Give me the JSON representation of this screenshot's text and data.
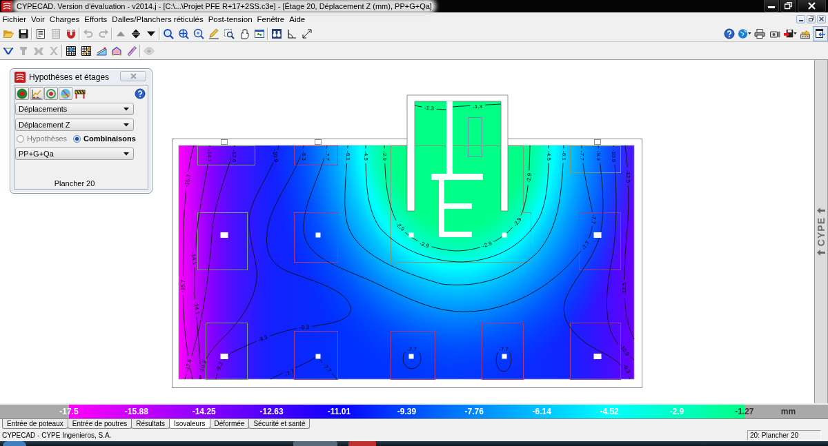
{
  "window": {
    "title": "CYPECAD. Version d'évaluation - v2014.j - [C:\\...\\Projet PFE R+17+2SS.c3e] - [Étage 20, Déplacement Z (mm), PP+G+Qa]"
  },
  "menu": [
    "Fichier",
    "Voir",
    "Charges",
    "Efforts",
    "Dalles/Planchers réticulés",
    "Post-tension",
    "Fenêtre",
    "Aide"
  ],
  "toolbar_main": [
    {
      "disabled": false
    },
    {
      "disabled": false
    },
    {
      "disabled": false
    },
    {
      "disabled": true
    },
    {
      "disabled": false
    },
    {
      "disabled": true
    },
    {
      "disabled": true
    },
    {
      "disabled": true
    },
    {
      "disabled": false
    },
    {
      "disabled": false
    },
    {
      "disabled": false
    },
    {
      "disabled": false
    },
    {
      "disabled": false
    },
    {
      "disabled": false
    },
    {
      "disabled": false
    },
    {
      "disabled": false
    },
    {
      "disabled": false
    },
    {
      "disabled": false
    },
    {
      "disabled": false
    },
    {
      "disabled": false
    }
  ],
  "toolbar_right": [
    {
      "pressed": false
    },
    {
      "pressed": false
    },
    {
      "pressed": false
    },
    {
      "pressed": false
    },
    {
      "pressed": false
    },
    {
      "pressed": false
    },
    {
      "pressed": true
    }
  ],
  "toolbar_results": [
    {
      "disabled": false
    },
    {
      "disabled": true
    },
    {
      "disabled": true
    },
    {
      "disabled": true
    },
    {
      "disabled": false
    },
    {
      "disabled": false
    },
    {
      "disabled": false
    },
    {
      "disabled": false
    },
    {
      "disabled": false
    },
    {
      "disabled": true
    }
  ],
  "panel": {
    "title": "Hypothèses et étages",
    "result_type": "Déplacements",
    "component": "Déplacement Z",
    "load_mode": [
      {
        "label": "Hypothèses",
        "selected": false
      },
      {
        "label": "Combinaisons",
        "selected": true
      }
    ],
    "combination": "PP+G+Qa",
    "floor": "Plancher 20"
  },
  "plan": {
    "contour_labels": [
      "-1.3",
      "-1.3",
      "-14.1",
      "-12.6",
      "-10.9",
      "-9.3",
      "-7.7",
      "-6.1",
      "-4.5",
      "-2.9",
      "-4.5",
      "-6.1",
      "-7.7",
      "-9.3",
      "-10.9",
      "-12.5",
      "-2.9",
      "-15.7",
      "-7.7",
      "-2.9",
      "-2.9",
      "-2.9",
      "-7.7",
      "-2.9",
      "-14.1",
      "-15.7",
      "-12.5",
      "-14.1",
      "-9.3",
      "-9.3",
      "-10.9",
      "-7.7",
      "-7.7",
      "-12.5",
      "-10.9",
      "-9.3",
      "-7.7",
      "-9.3",
      "-7.7"
    ]
  },
  "side_bar": {
    "label": "CYPE"
  },
  "legend": {
    "values": [
      "-17.5",
      "-15.88",
      "-14.25",
      "-12.63",
      "-11.01",
      "-9.39",
      "-7.76",
      "-6.14",
      "-4.52",
      "-2.9",
      "-1.27"
    ],
    "unit": "mm"
  },
  "tabs": [
    {
      "label": "Entrée de poteaux",
      "selected": false
    },
    {
      "label": "Entrée de poutres",
      "selected": false
    },
    {
      "label": "Résultats",
      "selected": false
    },
    {
      "label": "Isovaleurs",
      "selected": true
    },
    {
      "label": "Déformée",
      "selected": false
    },
    {
      "label": "Sécurité et santé",
      "selected": false
    }
  ],
  "status_bar": {
    "text": "CYPECAD - CYPE Ingenieros, S.A.",
    "floor": "20: Plancher 20"
  }
}
